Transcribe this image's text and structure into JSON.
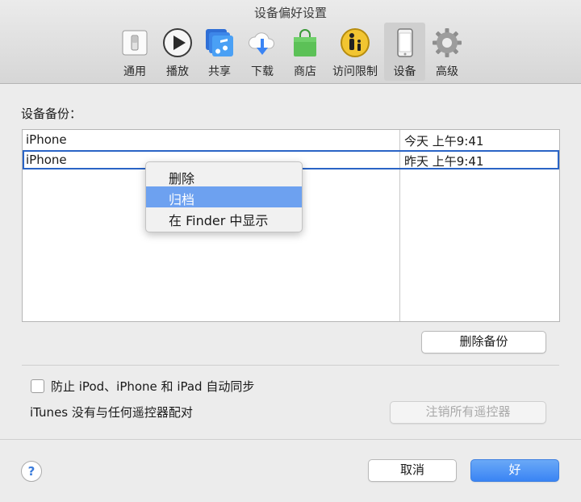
{
  "window": {
    "title": "设备偏好设置"
  },
  "tabs": [
    {
      "label": "通用",
      "icon": "general-switch-icon"
    },
    {
      "label": "播放",
      "icon": "play-icon"
    },
    {
      "label": "共享",
      "icon": "music-share-icon"
    },
    {
      "label": "下载",
      "icon": "cloud-download-icon"
    },
    {
      "label": "商店",
      "icon": "shopping-bag-icon"
    },
    {
      "label": "访问限制",
      "icon": "parental-control-icon"
    },
    {
      "label": "设备",
      "icon": "iphone-device-icon"
    },
    {
      "label": "高级",
      "icon": "gear-icon"
    }
  ],
  "selected_tab": "设备",
  "backups": {
    "label": "设备备份：",
    "rows": [
      {
        "name": "iPhone",
        "date": "今天 上午9:41"
      },
      {
        "name": "iPhone",
        "date": "昨天 上午9:41"
      }
    ]
  },
  "context_menu": {
    "items": [
      "删除",
      "归档",
      "在 Finder 中显示"
    ],
    "highlighted": "归档"
  },
  "buttons": {
    "delete_backup": "删除备份",
    "unpair_remotes": "注销所有遥控器",
    "cancel": "取消",
    "ok": "好",
    "help": "?"
  },
  "sync": {
    "prevent_label": "防止 iPod、iPhone 和 iPad 自动同步",
    "checked": false
  },
  "remote": {
    "status": "iTunes 没有与任何遥控器配对"
  },
  "colors": {
    "accent": "#3a84f4",
    "highlight": "#6da1f0",
    "selection_border": "#2a64c6"
  }
}
